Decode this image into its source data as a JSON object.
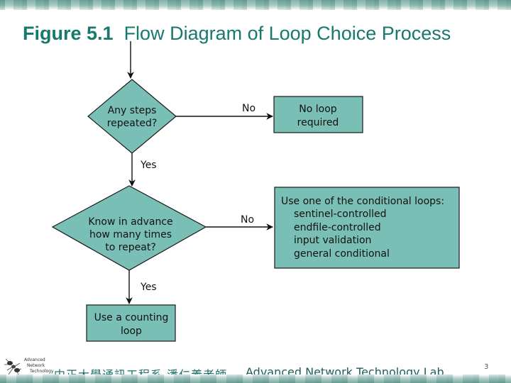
{
  "slide": {
    "title_figure": "Figure 5.1",
    "title_text": "Flow Diagram of Loop Choice Process",
    "page_number": "3"
  },
  "colors": {
    "title": "#17786e",
    "node_fill": "#79bfb5",
    "node_stroke": "#1a1a1a",
    "edge": "#111111"
  },
  "diagram": {
    "nodes": {
      "decision1": {
        "shape": "diamond",
        "lines": [
          "Any steps",
          "repeated?"
        ]
      },
      "no_loop": {
        "shape": "rectangle",
        "lines": [
          "No loop",
          "required"
        ]
      },
      "decision2": {
        "shape": "diamond",
        "lines": [
          "Know in advance",
          "how many times",
          "to repeat?"
        ]
      },
      "conditional": {
        "shape": "rectangle",
        "lines": [
          "Use one of the conditional loops:",
          "sentinel-controlled",
          "endfile-controlled",
          "input validation",
          "general conditional"
        ]
      },
      "counting": {
        "shape": "rectangle",
        "lines": [
          "Use a counting",
          "loop"
        ]
      }
    },
    "edges": [
      {
        "from": "start",
        "to": "decision1",
        "label": ""
      },
      {
        "from": "decision1",
        "to": "no_loop",
        "label": "No"
      },
      {
        "from": "decision1",
        "to": "decision2",
        "label": "Yes"
      },
      {
        "from": "decision2",
        "to": "conditional",
        "label": "No"
      },
      {
        "from": "decision2",
        "to": "counting",
        "label": "Yes"
      }
    ]
  },
  "footer": {
    "logo_lines": [
      "Advanced",
      "Network",
      "Technology"
    ],
    "chinese_text": "中正大學通訊工程系 潘仁義老師",
    "lab_name": "Advanced Network Technology Lab"
  }
}
